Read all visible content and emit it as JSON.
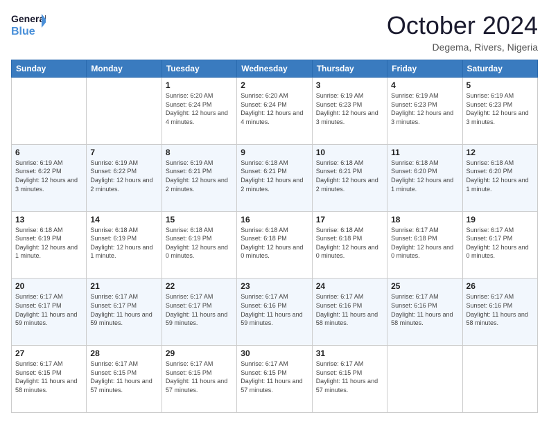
{
  "logo": {
    "line1": "General",
    "line2": "Blue"
  },
  "title": "October 2024",
  "subtitle": "Degema, Rivers, Nigeria",
  "days": [
    "Sunday",
    "Monday",
    "Tuesday",
    "Wednesday",
    "Thursday",
    "Friday",
    "Saturday"
  ],
  "weeks": [
    [
      {
        "date": "",
        "info": ""
      },
      {
        "date": "",
        "info": ""
      },
      {
        "date": "1",
        "info": "Sunrise: 6:20 AM\nSunset: 6:24 PM\nDaylight: 12 hours and 4 minutes."
      },
      {
        "date": "2",
        "info": "Sunrise: 6:20 AM\nSunset: 6:24 PM\nDaylight: 12 hours and 4 minutes."
      },
      {
        "date": "3",
        "info": "Sunrise: 6:19 AM\nSunset: 6:23 PM\nDaylight: 12 hours and 3 minutes."
      },
      {
        "date": "4",
        "info": "Sunrise: 6:19 AM\nSunset: 6:23 PM\nDaylight: 12 hours and 3 minutes."
      },
      {
        "date": "5",
        "info": "Sunrise: 6:19 AM\nSunset: 6:23 PM\nDaylight: 12 hours and 3 minutes."
      }
    ],
    [
      {
        "date": "6",
        "info": "Sunrise: 6:19 AM\nSunset: 6:22 PM\nDaylight: 12 hours and 3 minutes."
      },
      {
        "date": "7",
        "info": "Sunrise: 6:19 AM\nSunset: 6:22 PM\nDaylight: 12 hours and 2 minutes."
      },
      {
        "date": "8",
        "info": "Sunrise: 6:19 AM\nSunset: 6:21 PM\nDaylight: 12 hours and 2 minutes."
      },
      {
        "date": "9",
        "info": "Sunrise: 6:18 AM\nSunset: 6:21 PM\nDaylight: 12 hours and 2 minutes."
      },
      {
        "date": "10",
        "info": "Sunrise: 6:18 AM\nSunset: 6:21 PM\nDaylight: 12 hours and 2 minutes."
      },
      {
        "date": "11",
        "info": "Sunrise: 6:18 AM\nSunset: 6:20 PM\nDaylight: 12 hours and 1 minute."
      },
      {
        "date": "12",
        "info": "Sunrise: 6:18 AM\nSunset: 6:20 PM\nDaylight: 12 hours and 1 minute."
      }
    ],
    [
      {
        "date": "13",
        "info": "Sunrise: 6:18 AM\nSunset: 6:19 PM\nDaylight: 12 hours and 1 minute."
      },
      {
        "date": "14",
        "info": "Sunrise: 6:18 AM\nSunset: 6:19 PM\nDaylight: 12 hours and 1 minute."
      },
      {
        "date": "15",
        "info": "Sunrise: 6:18 AM\nSunset: 6:19 PM\nDaylight: 12 hours and 0 minutes."
      },
      {
        "date": "16",
        "info": "Sunrise: 6:18 AM\nSunset: 6:18 PM\nDaylight: 12 hours and 0 minutes."
      },
      {
        "date": "17",
        "info": "Sunrise: 6:18 AM\nSunset: 6:18 PM\nDaylight: 12 hours and 0 minutes."
      },
      {
        "date": "18",
        "info": "Sunrise: 6:17 AM\nSunset: 6:18 PM\nDaylight: 12 hours and 0 minutes."
      },
      {
        "date": "19",
        "info": "Sunrise: 6:17 AM\nSunset: 6:17 PM\nDaylight: 12 hours and 0 minutes."
      }
    ],
    [
      {
        "date": "20",
        "info": "Sunrise: 6:17 AM\nSunset: 6:17 PM\nDaylight: 11 hours and 59 minutes."
      },
      {
        "date": "21",
        "info": "Sunrise: 6:17 AM\nSunset: 6:17 PM\nDaylight: 11 hours and 59 minutes."
      },
      {
        "date": "22",
        "info": "Sunrise: 6:17 AM\nSunset: 6:17 PM\nDaylight: 11 hours and 59 minutes."
      },
      {
        "date": "23",
        "info": "Sunrise: 6:17 AM\nSunset: 6:16 PM\nDaylight: 11 hours and 59 minutes."
      },
      {
        "date": "24",
        "info": "Sunrise: 6:17 AM\nSunset: 6:16 PM\nDaylight: 11 hours and 58 minutes."
      },
      {
        "date": "25",
        "info": "Sunrise: 6:17 AM\nSunset: 6:16 PM\nDaylight: 11 hours and 58 minutes."
      },
      {
        "date": "26",
        "info": "Sunrise: 6:17 AM\nSunset: 6:16 PM\nDaylight: 11 hours and 58 minutes."
      }
    ],
    [
      {
        "date": "27",
        "info": "Sunrise: 6:17 AM\nSunset: 6:15 PM\nDaylight: 11 hours and 58 minutes."
      },
      {
        "date": "28",
        "info": "Sunrise: 6:17 AM\nSunset: 6:15 PM\nDaylight: 11 hours and 57 minutes."
      },
      {
        "date": "29",
        "info": "Sunrise: 6:17 AM\nSunset: 6:15 PM\nDaylight: 11 hours and 57 minutes."
      },
      {
        "date": "30",
        "info": "Sunrise: 6:17 AM\nSunset: 6:15 PM\nDaylight: 11 hours and 57 minutes."
      },
      {
        "date": "31",
        "info": "Sunrise: 6:17 AM\nSunset: 6:15 PM\nDaylight: 11 hours and 57 minutes."
      },
      {
        "date": "",
        "info": ""
      },
      {
        "date": "",
        "info": ""
      }
    ]
  ]
}
